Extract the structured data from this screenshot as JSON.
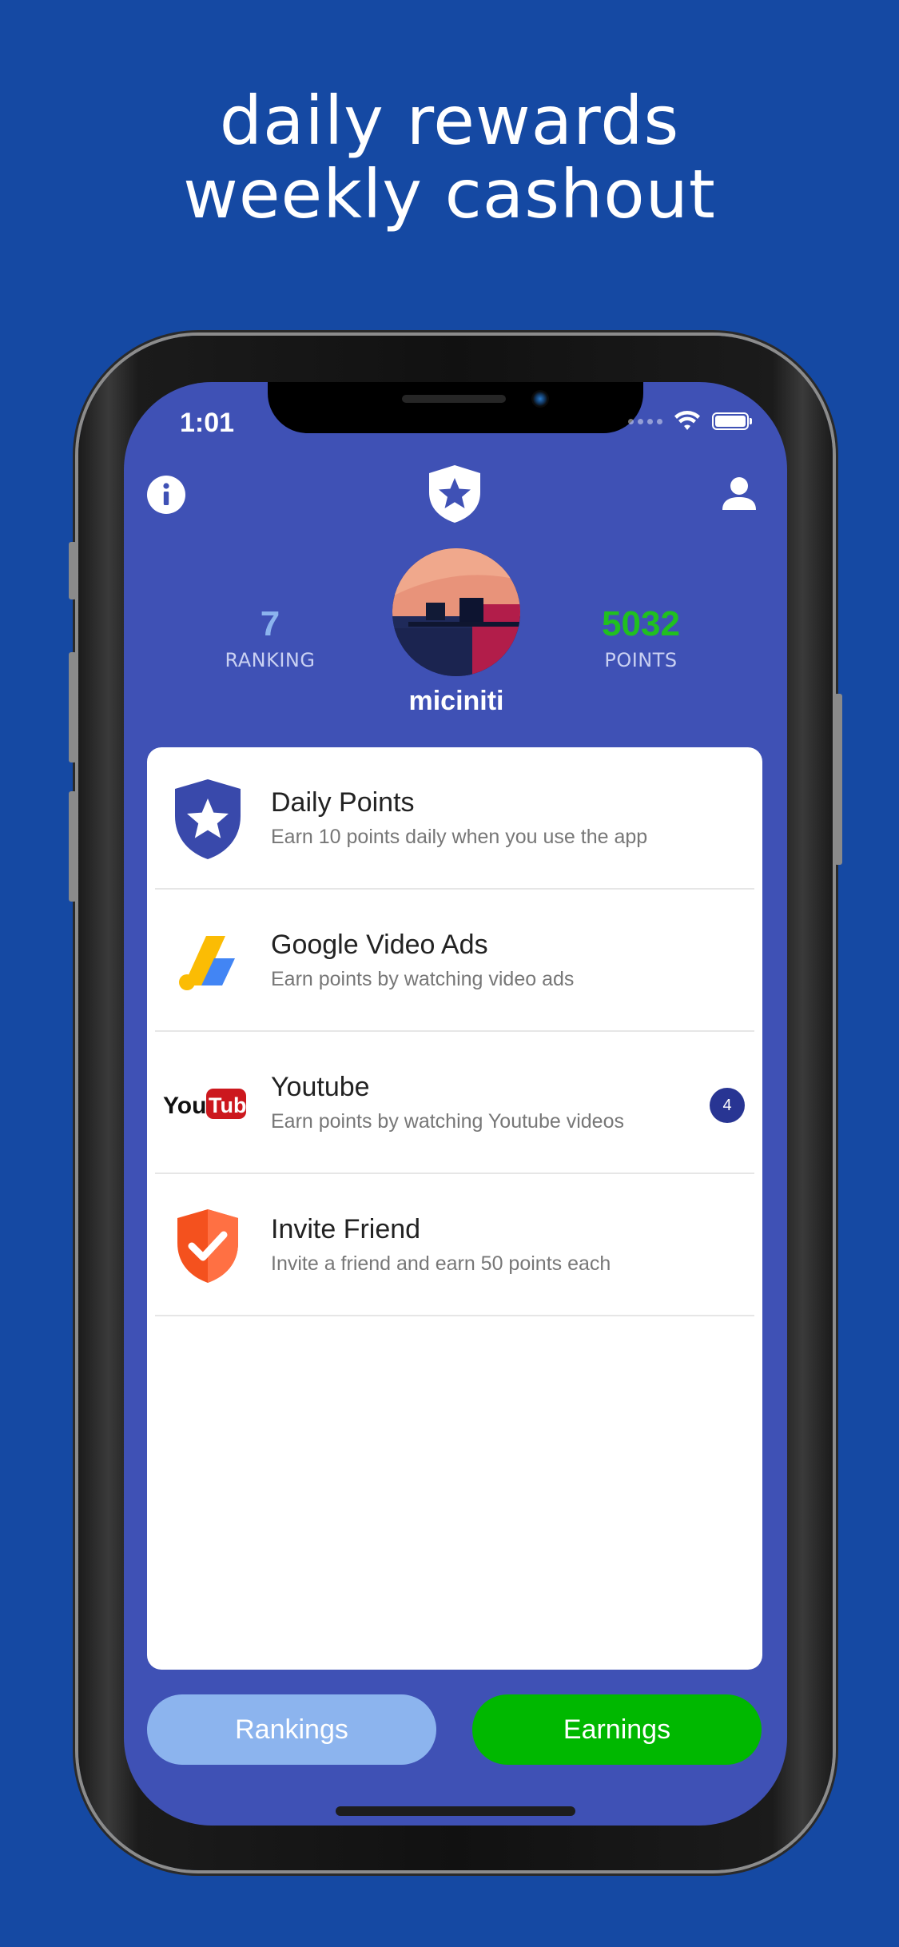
{
  "headline": {
    "line1": "daily rewards",
    "line2": "weekly cashout"
  },
  "status_bar": {
    "time": "1:01"
  },
  "nav": {
    "left_icon": "info-icon",
    "center_icon": "shield-star-logo-icon",
    "right_icon": "profile-icon"
  },
  "profile": {
    "username": "miciniti",
    "ranking_value": "7",
    "ranking_label": "RANKING",
    "points_value": "5032",
    "points_label": "POINTS"
  },
  "colors": {
    "background": "#1549a3",
    "screen": "#3f51b5",
    "ranking_value": "#8cb4ee",
    "points_value": "#20c020",
    "rankings_button": "#8cb4ee",
    "earnings_button": "#00b800",
    "badge": "#283593"
  },
  "earn_list": [
    {
      "title": "Daily Points",
      "subtitle": "Earn 10 points daily when you use the app",
      "icon": "shield-star-icon"
    },
    {
      "title": "Google Video Ads",
      "subtitle": "Earn points by watching video ads",
      "icon": "google-ads-icon"
    },
    {
      "title": "Youtube",
      "subtitle": "Earn points by watching Youtube videos",
      "icon": "youtube-logo-icon",
      "badge": "4"
    },
    {
      "title": "Invite Friend",
      "subtitle": "Invite a friend and earn 50 points each",
      "icon": "shield-check-icon"
    }
  ],
  "bottom_buttons": {
    "rankings": "Rankings",
    "earnings": "Earnings"
  }
}
